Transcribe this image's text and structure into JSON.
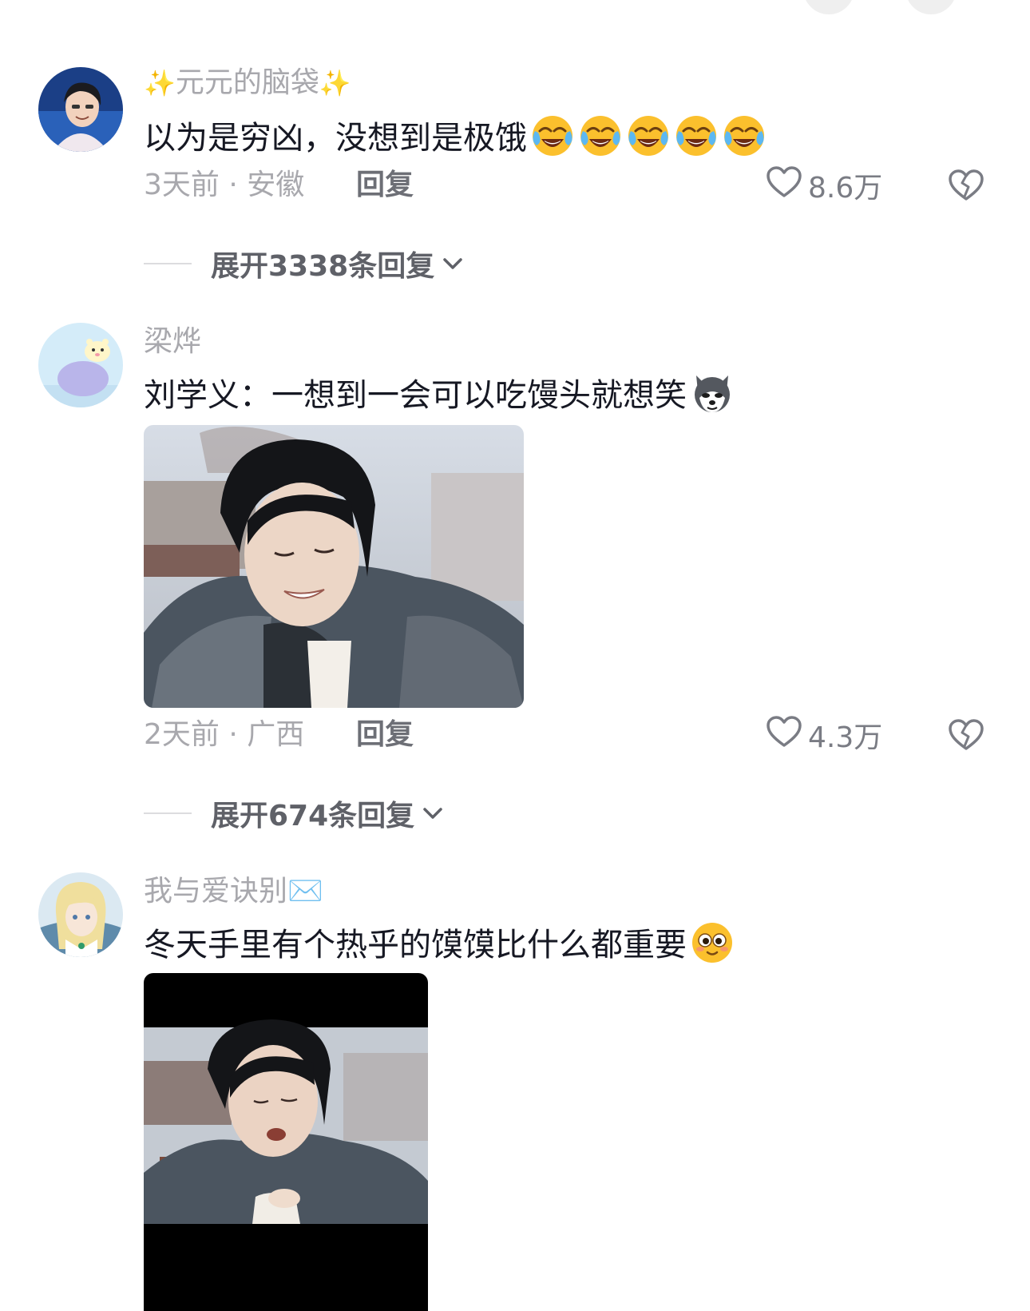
{
  "comments": [
    {
      "username": "元元的脑袋",
      "username_prefix_emoji": "✨",
      "username_suffix_emoji": "✨",
      "text": "以为是穷凶，没想到是极饿",
      "text_emojis": [
        "crying-laughing-emoji",
        "crying-laughing-emoji",
        "crying-laughing-emoji",
        "crying-laughing-emoji",
        "crying-laughing-emoji"
      ],
      "meta": "3天前 · 安徽",
      "reply_label": "回复",
      "likes": "8.6万",
      "expand_label": "展开3338条回复"
    },
    {
      "username": "梁烨",
      "text": "刘学义：一想到一会可以吃馒头就想笑",
      "text_emojis": [
        "husky-dog-emoji"
      ],
      "image": "smiling-man-in-fur-collar-photo",
      "meta": "2天前 · 广西",
      "reply_label": "回复",
      "likes": "4.3万",
      "expand_label": "展开674条回复"
    },
    {
      "username": "我与爱诀别",
      "username_suffix_emoji": "✉️",
      "text": "冬天手里有个热乎的馍馍比什么都重要",
      "text_emojis": [
        "cute-smile-emoji"
      ],
      "image": "man-in-fur-collar-eating-photo"
    }
  ],
  "colors": {
    "primary_text": "#161823",
    "secondary_text": "#a8a8ad",
    "reply_text": "#6d6f76",
    "emoji_yellow": "#fbc02d"
  }
}
